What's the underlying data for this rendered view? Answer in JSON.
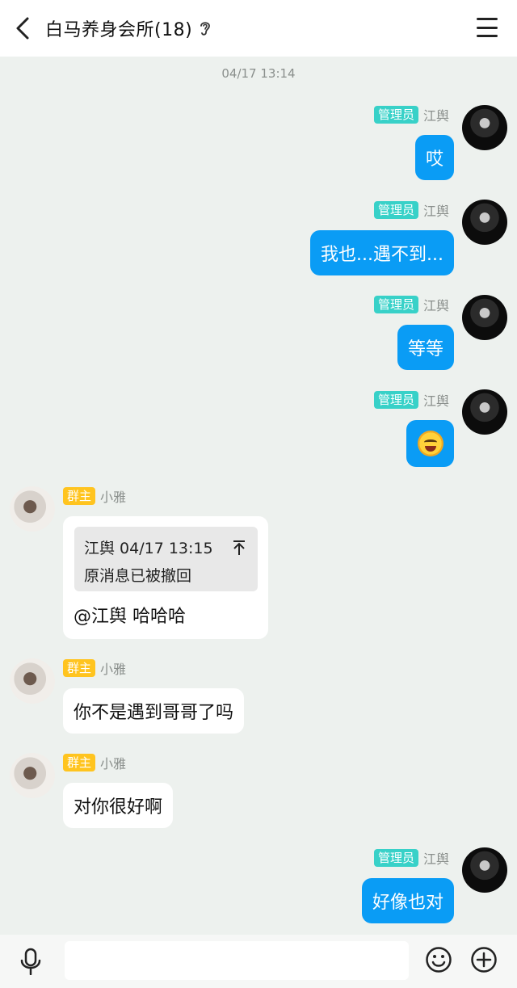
{
  "header": {
    "title": "白马养身会所(18)",
    "back_icon": "chevron-left-icon",
    "ear_icon": "ear-icon",
    "menu_icon": "hamburger-menu-icon"
  },
  "timestamp": "04/17 13:14",
  "messages": [
    {
      "sender": "江舆",
      "role": "管理员",
      "text": "哎"
    },
    {
      "sender": "江舆",
      "role": "管理员",
      "text": "我也...遇不到..."
    },
    {
      "sender": "江舆",
      "role": "管理员",
      "text": "等等"
    },
    {
      "sender": "江舆",
      "role": "管理员",
      "emoji": "laughing-face-emoji"
    },
    {
      "sender": "小雅",
      "role": "群主",
      "quote": {
        "header": "江舆 04/17 13:15",
        "text": "原消息已被撤回"
      },
      "text": "@江舆 哈哈哈"
    },
    {
      "sender": "小雅",
      "role": "群主",
      "text": "你不是遇到哥哥了吗"
    },
    {
      "sender": "小雅",
      "role": "群主",
      "text": "对你很好啊"
    },
    {
      "sender": "江舆",
      "role": "管理员",
      "text": "好像也对"
    }
  ],
  "bottom_bar": {
    "icons": [
      "microphone-icon",
      "emoji-icon",
      "plus-icon"
    ],
    "input_value": ""
  },
  "colors": {
    "my_bubble": "#0a9cf5",
    "admin_badge": "#38d1c8",
    "owner_badge": "#ffc41f",
    "background": "#edf1ee"
  }
}
